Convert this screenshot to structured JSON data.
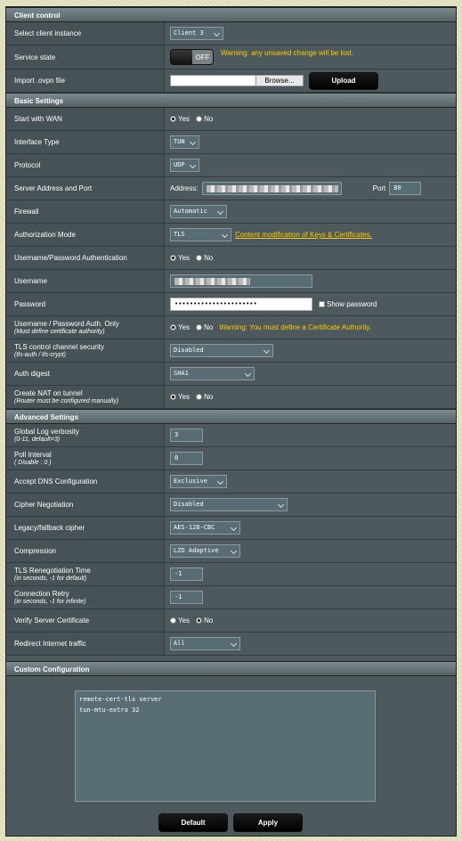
{
  "client_control": {
    "title": "Client control",
    "select_instance": {
      "label": "Select client instance",
      "value": "Client 3"
    },
    "service_state": {
      "label": "Service state",
      "toggle": "OFF",
      "warning": "Warning: any unsaved change will be lost."
    },
    "import_ovpn": {
      "label": "Import .ovpn file",
      "browse": "Browse...",
      "upload": "Upload"
    }
  },
  "basic": {
    "title": "Basic Settings",
    "start_wan": {
      "label": "Start with WAN",
      "yes": "Yes",
      "no": "No",
      "selected": "Yes"
    },
    "interface_type": {
      "label": "Interface Type",
      "value": "TUN"
    },
    "protocol": {
      "label": "Protocol",
      "value": "UDP"
    },
    "server": {
      "label": "Server Address and Port",
      "address_label": "Address:",
      "port_label": "Port",
      "port": "80"
    },
    "firewall": {
      "label": "Firewall",
      "value": "Automatic"
    },
    "auth_mode": {
      "label": "Authorization Mode",
      "value": "TLS",
      "link": "Content modification of Keys & Certificates."
    },
    "userpass_auth": {
      "label": "Username/Password Authentication",
      "yes": "Yes",
      "no": "No",
      "selected": "Yes"
    },
    "username": {
      "label": "Username"
    },
    "password": {
      "label": "Password",
      "value": "••••••••••••••••••••••",
      "show": "Show password"
    },
    "userpass_only": {
      "label": "Username / Password Auth. Only",
      "sub": "(Must define certificate authority)",
      "yes": "Yes",
      "no": "No",
      "selected": "Yes",
      "warning": "Warning: You must define a Certificate Authority."
    },
    "tls_channel": {
      "label": "TLS control channel security",
      "sub": "(tls-auth / tls-crypt)",
      "value": "Disabled"
    },
    "auth_digest": {
      "label": "Auth digest",
      "value": "SHA1"
    },
    "create_nat": {
      "label": "Create NAT on tunnel",
      "sub": "(Router must be configured manually)",
      "yes": "Yes",
      "no": "No",
      "selected": "Yes"
    }
  },
  "advanced": {
    "title": "Advanced Settings",
    "log_verbosity": {
      "label": "Global Log verbosity",
      "sub": "(0-11, default=3)",
      "value": "3"
    },
    "poll_interval": {
      "label": "Poll Interval",
      "sub": "( Disable : 0 )",
      "value": "0"
    },
    "accept_dns": {
      "label": "Accept DNS Configuration",
      "value": "Exclusive"
    },
    "cipher_negotiation": {
      "label": "Cipher Negotiation",
      "value": "Disabled"
    },
    "legacy_cipher": {
      "label": "Legacy/fallback cipher",
      "value": "AES-128-CBC"
    },
    "compression": {
      "label": "Compression",
      "value": "LZO Adaptive"
    },
    "tls_reneg": {
      "label": "TLS Renegotiation Time",
      "sub": "(in seconds, -1 for default)",
      "value": "-1"
    },
    "conn_retry": {
      "label": "Connection Retry",
      "sub": "(in seconds, -1 for infinite)",
      "value": "-1"
    },
    "verify_cert": {
      "label": "Verify Server Certificate",
      "yes": "Yes",
      "no": "No",
      "selected": "No"
    },
    "redirect": {
      "label": "Redirect Internet traffic",
      "value": "All"
    }
  },
  "custom": {
    "title": "Custom Configuration",
    "text": "remote-cert-tls server\ntun-mtu-extra 32"
  },
  "buttons": {
    "default": "Default",
    "apply": "Apply"
  }
}
